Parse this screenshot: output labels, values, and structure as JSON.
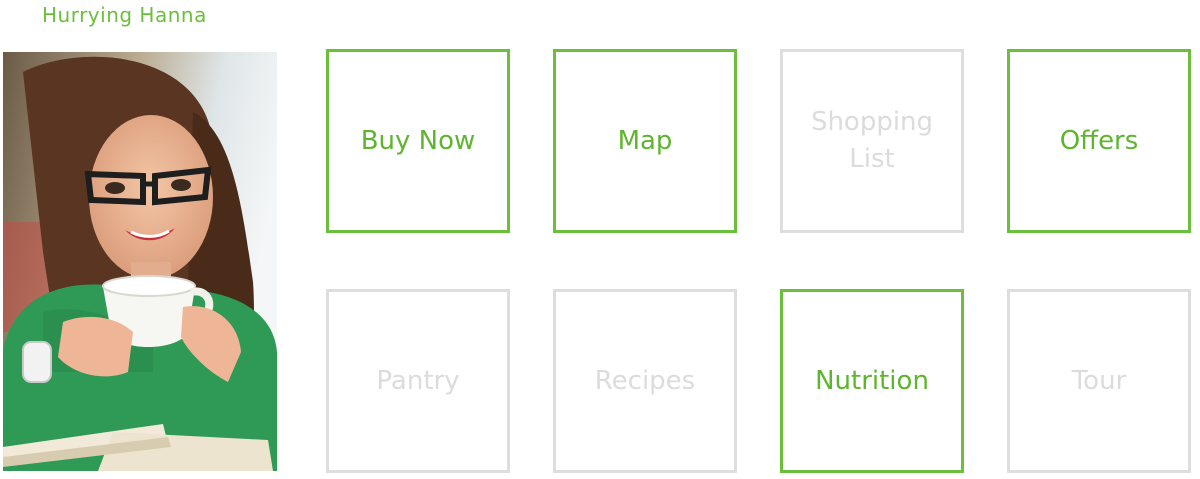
{
  "persona": {
    "name": "Hurrying Hanna"
  },
  "colors": {
    "accent": "#6cbf3c",
    "inactive": "#dedede"
  },
  "tiles": [
    {
      "label": "Buy Now",
      "state": "active"
    },
    {
      "label": "Map",
      "state": "active"
    },
    {
      "label": "Shopping List",
      "state": "inactive"
    },
    {
      "label": "Offers",
      "state": "active"
    },
    {
      "label": "Pantry",
      "state": "inactive"
    },
    {
      "label": "Recipes",
      "state": "inactive"
    },
    {
      "label": "Nutrition",
      "state": "active"
    },
    {
      "label": "Tour",
      "state": "inactive"
    }
  ]
}
